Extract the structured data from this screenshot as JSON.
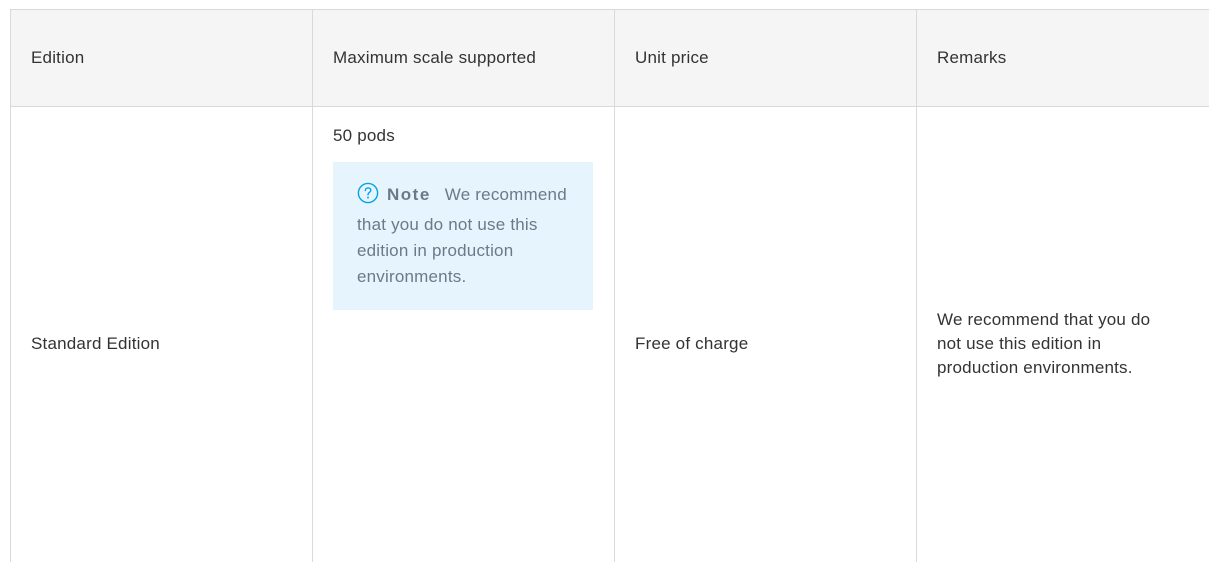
{
  "table": {
    "headers": [
      "Edition",
      "Maximum scale supported",
      "Unit price",
      "Remarks"
    ],
    "row": {
      "edition": "Standard Edition",
      "scale": "50 pods",
      "note": {
        "icon": "question-circle-icon",
        "title": "Note",
        "text": "We recommend that you do not use this edition in production environments."
      },
      "price": "Free of charge",
      "remarks": "We recommend that you do not use this edition in production environments."
    }
  },
  "colors": {
    "header_bg": "#f5f5f5",
    "border": "#d9d9d9",
    "note_bg": "#e6f4fd",
    "note_icon": "#00a2e8",
    "note_text": "#6b7a88"
  }
}
